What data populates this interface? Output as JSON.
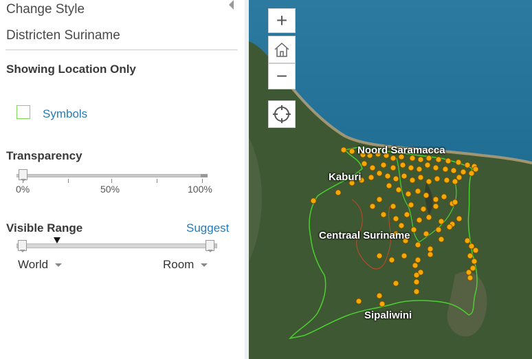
{
  "panel": {
    "title": "Change Style",
    "layer_name": "Districten Suriname",
    "showing": "Showing Location Only",
    "symbols_label": "Symbols",
    "transparency": {
      "label": "Transparency",
      "ticks": [
        "0%",
        "50%",
        "100%"
      ],
      "value_percent": 0
    },
    "visible_range": {
      "label": "Visible Range",
      "suggest": "Suggest",
      "min_scale": "World",
      "max_scale": "Room"
    }
  },
  "map": {
    "labels": {
      "noord": "Noord Saramacca",
      "kaburi": "Kaburi",
      "centraal": "Centraal Suriname",
      "sipaliwini": "Sipaliwini"
    },
    "zoom_in": "+",
    "zoom_out": "−",
    "colors": {
      "points": "#f7a800",
      "boundary": "#4bd12f",
      "ocean": "#1f6d8f",
      "land": "#3f5a33"
    }
  }
}
